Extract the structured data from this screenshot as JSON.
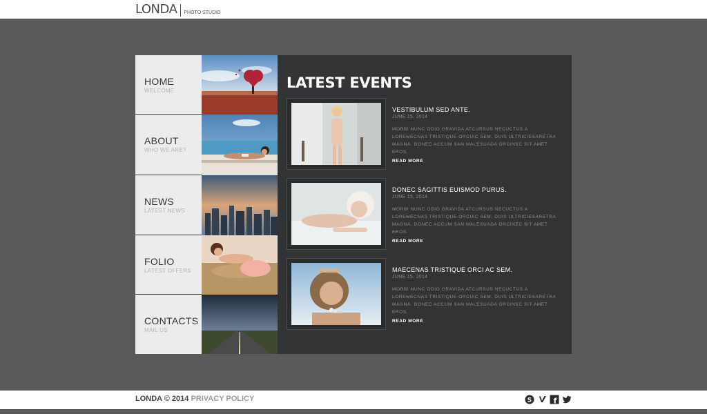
{
  "brand": {
    "name": "LONDA",
    "tagline": "PHOTO STUDIO"
  },
  "nav": [
    {
      "label": "HOME",
      "sub": "WELCOME"
    },
    {
      "label": "ABOUT",
      "sub": "WHO WE ARE?"
    },
    {
      "label": "NEWS",
      "sub": "LATEST NEWS"
    },
    {
      "label": "FOLIO",
      "sub": "LATEST OFFERS"
    },
    {
      "label": "CONTACTS",
      "sub": "MAIL US"
    }
  ],
  "main": {
    "heading": "LATEST EVENTS",
    "events": [
      {
        "title": "VESTIBULUM SED ANTE.",
        "date": "JUNE 15, 2014",
        "text": "MORBI NUNC ODIO GRAVIDA ATCURSUS NECUCTUS A LOREMECNAS TRISTIQUE ORCIAC SEM. DUIS ULTRICIESARETRA MAGNA. DONEC ACCUM SAN MALESUADA ORCINEC SIT AMET EROS.",
        "more": "READ MORE"
      },
      {
        "title": "DONEC SAGITTIS EUISMOD PURUS.",
        "date": "JUNE 15, 2014",
        "text": "MORBI NUNC ODIO GRAVIDA ATCURSUS NECUCTUS A LOREMECNAS TRISTIQUE ORCIAC SEM. DUIS ULTRICIESARETRA MAGNA. DONEC ACCUM SAN MALESUADA ORCINEC SIT AMET EROS.",
        "more": "READ MORE"
      },
      {
        "title": "MAECENAS TRISTIQUE ORCI AC SEM.",
        "date": "JUNE 15, 2014",
        "text": "MORBI NUNC ODIO GRAVIDA ATCURSUS NECUCTUS A LOREMECNAS TRISTIQUE ORCIAC SEM. DUIS ULTRICIESARETRA MAGNA. DONEC ACCUM SAN MALESUADA ORCINEC SIT AMET EROS.",
        "more": "READ MORE"
      }
    ]
  },
  "footer": {
    "copyright": "LONDA © 2014",
    "privacy": "PRIVACY POLICY",
    "social": [
      "skype-icon",
      "vimeo-icon",
      "facebook-icon",
      "twitter-icon"
    ]
  },
  "colors": {
    "background": "#5a5a5a",
    "panel": "#323335",
    "nav_bg": "#ececec",
    "header": "#ffffff"
  }
}
